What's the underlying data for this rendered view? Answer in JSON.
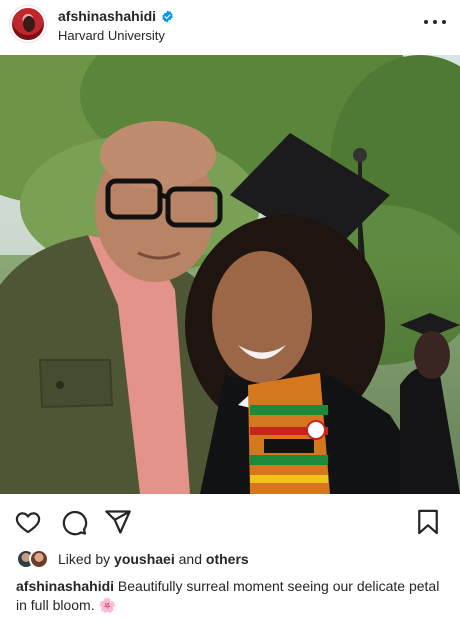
{
  "post": {
    "username": "afshinashahidi",
    "location": "Harvard University",
    "verified_icon": "verified-badge-icon",
    "more_icon": "more-options-icon"
  },
  "actions": {
    "like_icon": "heart-icon",
    "comment_icon": "comment-icon",
    "share_icon": "share-icon",
    "save_icon": "bookmark-icon"
  },
  "likes": {
    "prefix": "Liked by",
    "user": "youshaei",
    "conjunction": "and",
    "others": "others"
  },
  "caption": {
    "username": "afshinashahidi",
    "text": "Beautifully surreal moment seeing our delicate petal in full bloom.",
    "emoji": "🌸"
  },
  "colors": {
    "verified_blue": "#0095f6",
    "text": "#262626"
  }
}
